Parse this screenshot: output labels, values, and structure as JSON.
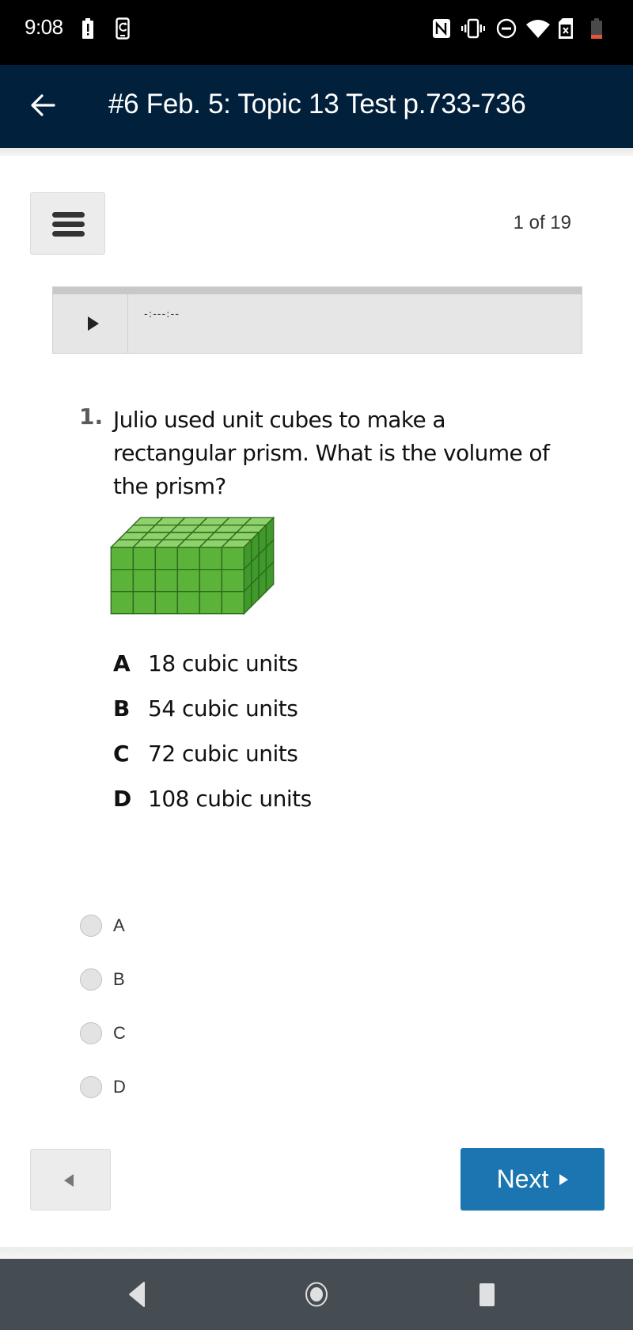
{
  "status_bar": {
    "time": "9:08",
    "left_icons": [
      "battery-alert-icon",
      "phone-sync-icon"
    ],
    "right_icons": [
      "nfc-icon",
      "vibrate-icon",
      "do-not-disturb-icon",
      "wifi-icon",
      "no-sim-icon",
      "battery-low-icon"
    ],
    "battery_color": "#e4563a"
  },
  "header": {
    "back_icon": "arrow-left-icon",
    "title": "#6 Feb. 5: Topic 13 Test p.733-736",
    "background": "#01203b"
  },
  "toolbar": {
    "menu_icon": "hamburger-menu-icon",
    "page_indicator": "1 of 19"
  },
  "audio_player": {
    "play_icon": "play-icon",
    "time_display": "-:---:--"
  },
  "question": {
    "number": "1.",
    "text": "Julio used unit cubes to make a rectangular prism. What is the volume of the prism?",
    "figure": {
      "description": "rectangular prism of green unit cubes",
      "front_columns": 6,
      "front_rows": 3,
      "depth": 4,
      "color": "#5bb33a"
    },
    "choices": [
      {
        "letter": "A",
        "text": "18 cubic units"
      },
      {
        "letter": "B",
        "text": "54 cubic units"
      },
      {
        "letter": "C",
        "text": "72 cubic units"
      },
      {
        "letter": "D",
        "text": "108 cubic units"
      }
    ]
  },
  "answer_options": [
    {
      "label": "A",
      "selected": false
    },
    {
      "label": "B",
      "selected": false
    },
    {
      "label": "C",
      "selected": false
    },
    {
      "label": "D",
      "selected": false
    }
  ],
  "navigation": {
    "prev_icon": "triangle-left-icon",
    "next_label": "Next",
    "next_icon": "triangle-right-icon",
    "next_color": "#1a75b0"
  },
  "system_nav": {
    "buttons": [
      "back-nav-icon",
      "home-nav-icon",
      "recents-nav-icon"
    ]
  }
}
